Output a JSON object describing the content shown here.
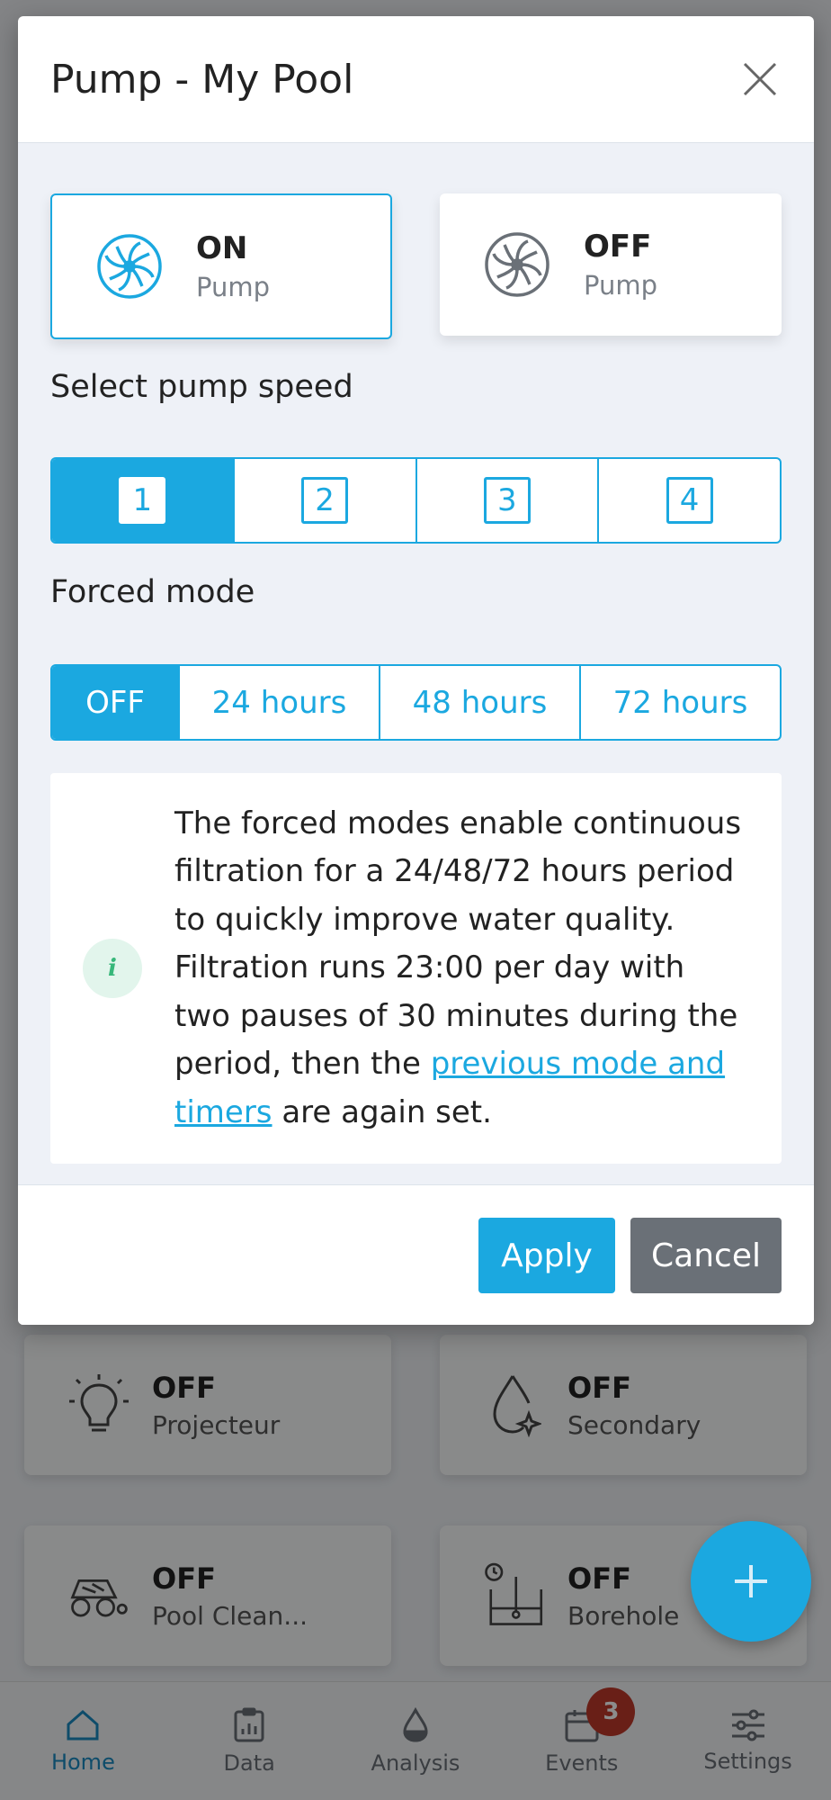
{
  "modal": {
    "title": "Pump - My Pool",
    "on_card": {
      "status": "ON",
      "name": "Pump"
    },
    "off_card": {
      "status": "OFF",
      "name": "Pump"
    },
    "speed_label": "Select pump speed",
    "speeds": [
      "1",
      "2",
      "3",
      "4"
    ],
    "selected_speed": "1",
    "forced_label": "Forced mode",
    "forced_options": [
      "OFF",
      "24 hours",
      "48 hours",
      "72 hours"
    ],
    "selected_forced": "OFF",
    "info": {
      "icon": "i",
      "text_before": "The forced modes enable continuous filtration for a 24/48/72 hours period to quickly improve water quality. Filtration runs 23:00 per day with two pauses of 30 minutes during the period, then the ",
      "link": "previous mode and timers",
      "text_after": " are again set."
    },
    "apply_label": "Apply",
    "cancel_label": "Cancel"
  },
  "tiles": [
    {
      "status": "OFF",
      "name": "Projecteur",
      "icon": "bulb-icon"
    },
    {
      "status": "OFF",
      "name": "Secondary",
      "icon": "drop-sparkle-icon"
    },
    {
      "status": "OFF",
      "name": "Pool Clean...",
      "icon": "robot-icon"
    },
    {
      "status": "OFF",
      "name": "Borehole",
      "icon": "borehole-icon"
    }
  ],
  "nav": [
    {
      "label": "Home",
      "icon": "home-icon",
      "active": true
    },
    {
      "label": "Data",
      "icon": "data-icon"
    },
    {
      "label": "Analysis",
      "icon": "drop-icon"
    },
    {
      "label": "Events",
      "icon": "calendar-icon",
      "badge": "3"
    },
    {
      "label": "Settings",
      "icon": "sliders-icon"
    }
  ],
  "colors": {
    "accent": "#1ba8e0",
    "cancel": "#6a7077",
    "badge": "#c0392b"
  }
}
